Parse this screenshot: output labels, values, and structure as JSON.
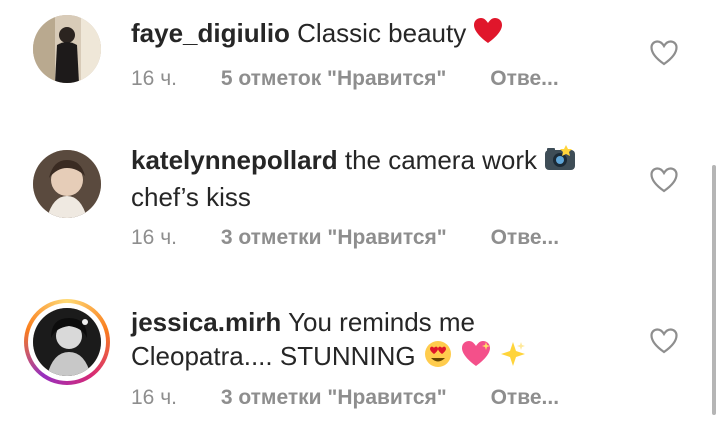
{
  "comments": [
    {
      "username": "faye_digiulio",
      "text": "Classic beauty",
      "time": "16 ч.",
      "likes": "5 отметок \"Нравится\"",
      "reply": "Отве...",
      "emoji": "heart-emoji"
    },
    {
      "username": "katelynnepollard",
      "text": "the camera work",
      "text2": "chef’s kiss",
      "time": "16 ч.",
      "likes": "3 отметки \"Нравится\"",
      "reply": "Отве...",
      "emoji": "camera-emoji"
    },
    {
      "username": "jessica.mirh",
      "text": "You reminds me",
      "text2": "Cleopatra.... STUNNING",
      "time": "16 ч.",
      "likes": "3 отметки \"Нравится\"",
      "reply": "Отве...",
      "emoji": "heart-eyes-sparkling-heart-sparkles-emoji"
    }
  ],
  "colors": {
    "text": "#262626",
    "muted": "#8e8e8e",
    "heart": "#ed4956"
  }
}
